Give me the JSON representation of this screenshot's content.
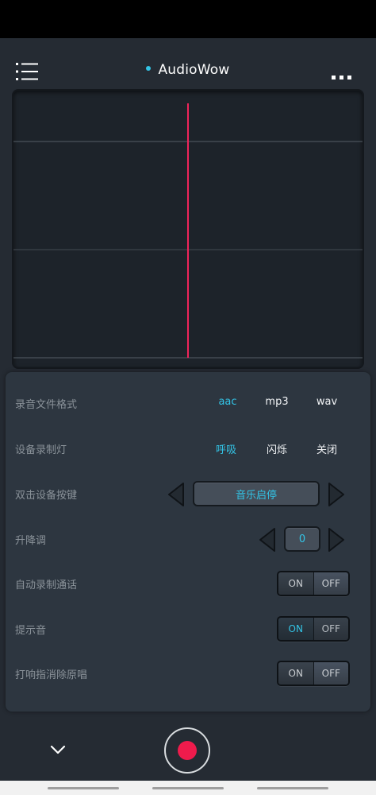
{
  "app": {
    "title": "AudioWow",
    "accent": "#33c4e6",
    "record_color": "#ef1b4c"
  },
  "header": {
    "menu_icon": "list-menu-icon",
    "more_icon": "more-dots-icon"
  },
  "waveform": {
    "playhead_color": "#f0245a",
    "grid_lines": 3
  },
  "settings": {
    "file_format": {
      "label": "录音文件格式",
      "options": [
        "aac",
        "mp3",
        "wav"
      ],
      "selected": "aac"
    },
    "light": {
      "label": "设备录制灯",
      "options": [
        "呼吸",
        "闪烁",
        "关闭"
      ],
      "selected": "呼吸"
    },
    "double_click": {
      "label": "双击设备按键",
      "value": "音乐启停"
    },
    "pitch": {
      "label": "升降调",
      "value": "0"
    },
    "auto_record_call": {
      "label": "自动录制通话",
      "on": "ON",
      "off": "OFF",
      "state": "off"
    },
    "prompt_tone": {
      "label": "提示音",
      "on": "ON",
      "off": "OFF",
      "state": "on"
    },
    "snap_remove_vocal": {
      "label": "打响指消除原唱",
      "on": "ON",
      "off": "OFF",
      "state": "off"
    }
  },
  "bottom": {
    "collapse_icon": "chevron-down-icon",
    "record_icon": "record-icon"
  }
}
